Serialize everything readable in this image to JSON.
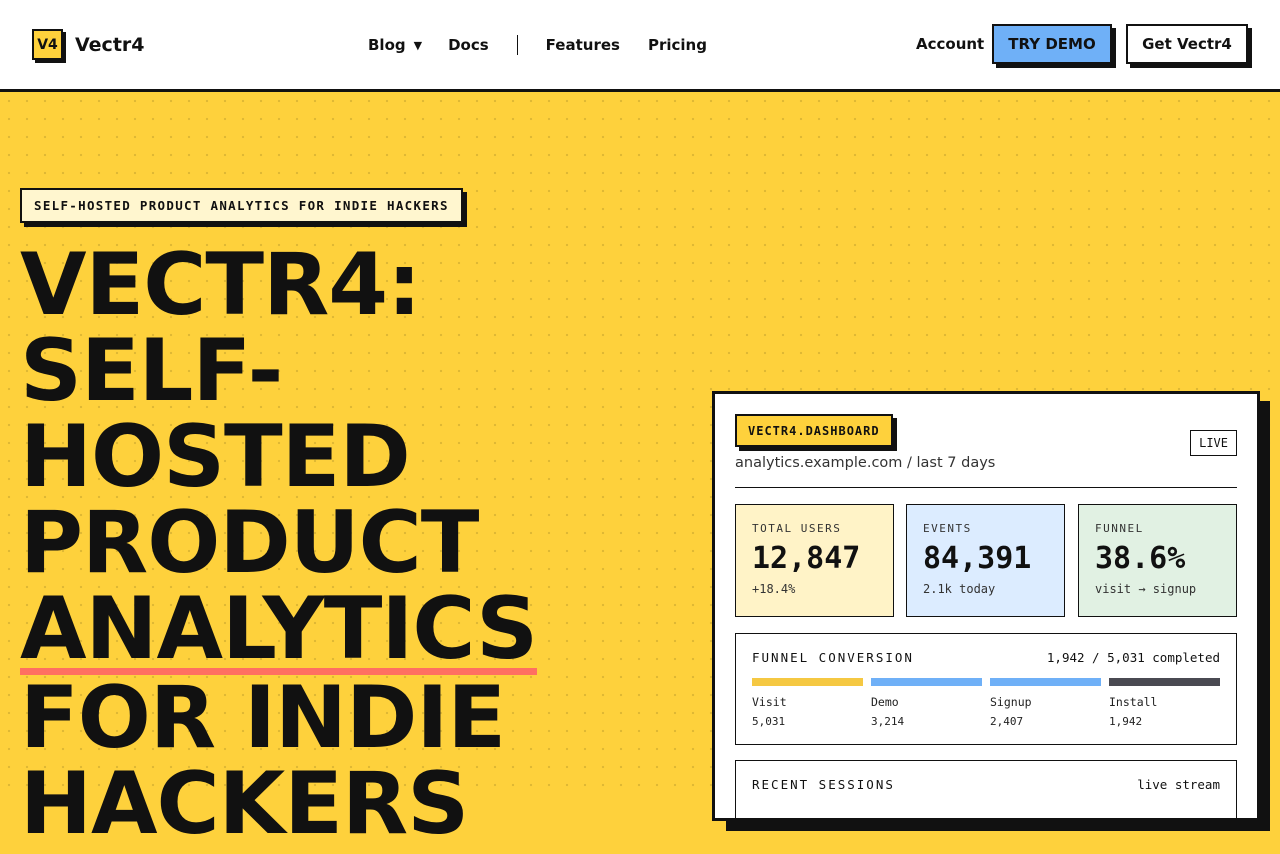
{
  "brand": {
    "badge": "V4",
    "name": "Vectr4"
  },
  "nav": {
    "blog": "Blog",
    "blog_caret": "▼",
    "docs": "Docs",
    "features": "Features",
    "pricing": "Pricing"
  },
  "actions": {
    "account": "Account",
    "try_demo": "TRY DEMO",
    "get": "Get Vectr4"
  },
  "hero": {
    "kicker": "SELF-HOSTED PRODUCT ANALYTICS FOR INDIE HACKERS",
    "headline_lines": [
      "VECTR4:",
      "SELF-",
      "HOSTED",
      "PRODUCT",
      "ANALYTICS",
      "FOR INDIE",
      "HACKERS"
    ]
  },
  "dashboard": {
    "tag": "VECTR4.DASHBOARD",
    "subtitle": "analytics.example.com / last 7 days",
    "live": "LIVE",
    "stats": [
      {
        "label": "TOTAL USERS",
        "value": "12,847",
        "note": "+18.4%"
      },
      {
        "label": "EVENTS",
        "value": "84,391",
        "note": "2.1k today"
      },
      {
        "label": "FUNNEL",
        "value": "38.6%",
        "note": "visit → signup"
      }
    ],
    "funnel": {
      "title": "FUNNEL CONVERSION",
      "summary": "1,942 / 5,031 completed",
      "steps": [
        {
          "name": "Visit",
          "count": "5,031",
          "color": "#f5c842"
        },
        {
          "name": "Demo",
          "count": "3,214",
          "color": "#6fb0f7"
        },
        {
          "name": "Signup",
          "count": "2,407",
          "color": "#6fb0f7"
        },
        {
          "name": "Install",
          "count": "1,942",
          "color": "#4a4a52"
        }
      ]
    },
    "sessions": {
      "title": "RECENT SESSIONS",
      "right": "live stream"
    }
  },
  "colors": {
    "background": "#fed13c",
    "accent_blue": "#6fb0f7",
    "underline": "#ff6f61",
    "ink": "#111111"
  }
}
